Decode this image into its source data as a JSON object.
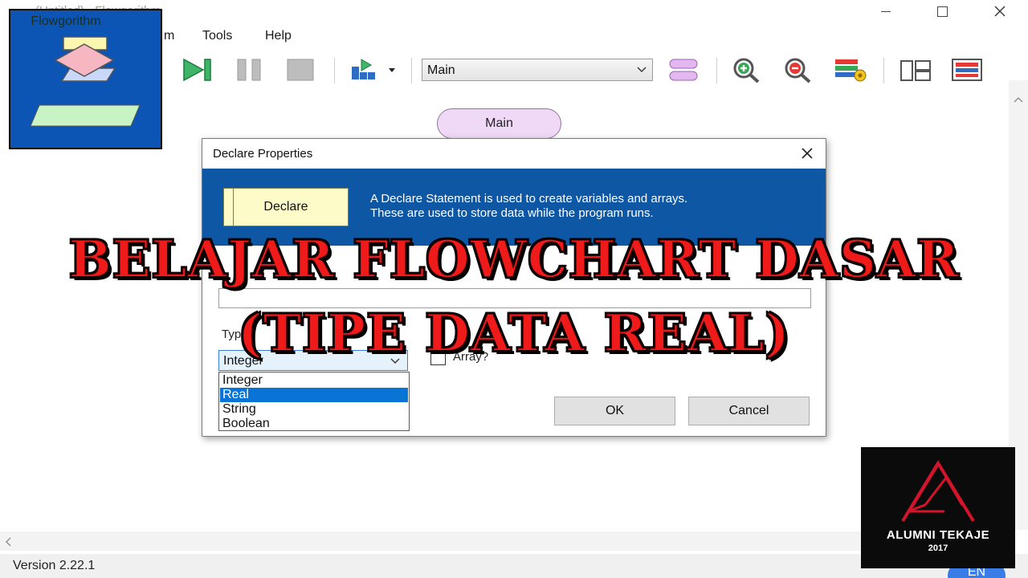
{
  "window": {
    "title": "(Untitled) - Flowgorithm",
    "minimize_glyph": "—",
    "maximize_glyph": "☐",
    "close_glyph": "✕"
  },
  "menu": {
    "items": [
      "m",
      "Tools",
      "Help"
    ]
  },
  "toolbar": {
    "function_select_value": "Main",
    "icons": [
      "run-icon",
      "pause-icon",
      "stop-icon",
      "step-icon",
      "layout-icon",
      "zoom-in-icon",
      "zoom-out-icon",
      "variables-icon",
      "split-view-icon",
      "console-icon"
    ]
  },
  "canvas": {
    "main_label": "Main"
  },
  "dialog": {
    "title": "Declare Properties",
    "banner_shape_label": "Declare",
    "banner_line1": "A Declare Statement is used to create variables and arrays.",
    "banner_line2": "These are used to store data while the program runs.",
    "name_value": "",
    "type_label": "Type:",
    "type_selected": "Integer",
    "array_label": "Array?",
    "array_checked": false,
    "type_options": [
      "Integer",
      "Real",
      "String",
      "Boolean"
    ],
    "highlighted_option": "Real",
    "ok_label": "OK",
    "cancel_label": "Cancel"
  },
  "status": {
    "version": "Version 2.22.1",
    "language": "EN"
  },
  "overlay": {
    "headline_line1": "BELAJAR FLOWCHART DASAR",
    "headline_line2": "(TIPE DATA REAL)",
    "headline_color": "#ef1b1b"
  },
  "logo": {
    "label": "Flowgorithm"
  },
  "badge": {
    "title": "ALUMNI TEKAJE",
    "year": "2017",
    "accent_color": "#d4142b"
  },
  "colors": {
    "banner": "#0e57a4",
    "main_oval": "#efd9f7",
    "selection": "#0a74d6"
  }
}
